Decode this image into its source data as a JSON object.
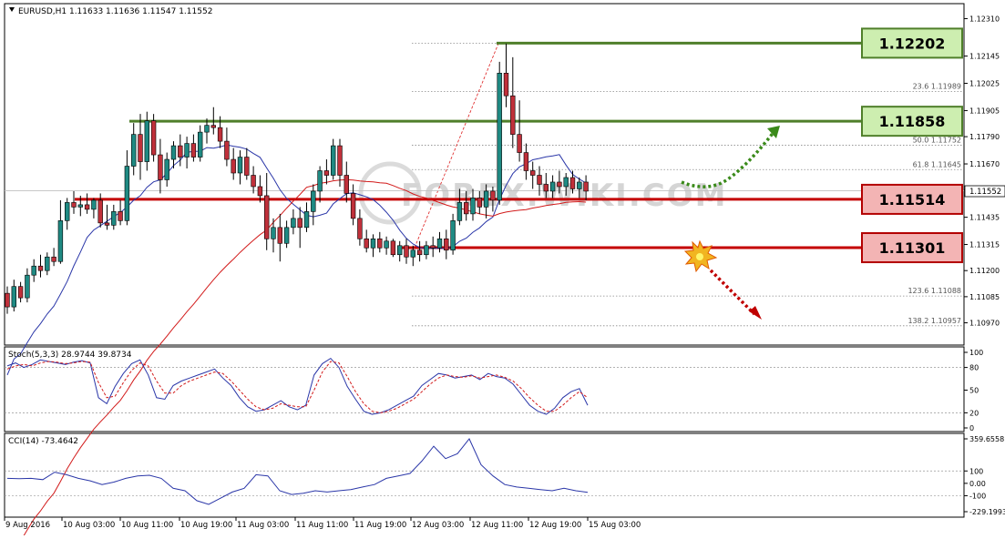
{
  "header": {
    "symbol_line": "EURUSD,H1  1.11633 1.11636 1.11547 1.11552"
  },
  "price_axis": {
    "ticks": [
      "1.12310",
      "1.12145",
      "1.12025",
      "1.11905",
      "1.11790",
      "1.11670",
      "1.11555",
      "1.11435",
      "1.11315",
      "1.11200",
      "1.11085",
      "1.10970"
    ],
    "current_price_label": "1.11552"
  },
  "levels": [
    {
      "label": "1.12202",
      "kind": "resistance"
    },
    {
      "label": "1.11858",
      "kind": "resistance"
    },
    {
      "label": "1.11514",
      "kind": "support"
    },
    {
      "label": "1.11301",
      "kind": "support"
    }
  ],
  "fibonacci": [
    {
      "label": "23.6  1.11989"
    },
    {
      "label": "50.0  1.11752"
    },
    {
      "label": "61.8  1.11645"
    },
    {
      "label": "123.6  1.11088"
    },
    {
      "label": "138.2  1.10957"
    }
  ],
  "stoch": {
    "title": "Stoch(5,3,3) 28.9744 39.8734",
    "ticks": [
      "100",
      "80",
      "50",
      "20",
      "0"
    ]
  },
  "cci": {
    "title": "CCI(14) -73.4642",
    "ticks": [
      "359.6558",
      "100",
      "0.00",
      "-100",
      "-229.1993"
    ]
  },
  "time_axis": {
    "labels": [
      "9 Aug 2016",
      "10 Aug 03:00",
      "10 Aug 11:00",
      "10 Aug 19:00",
      "11 Aug 03:00",
      "11 Aug 11:00",
      "11 Aug 19:00",
      "12 Aug 03:00",
      "12 Aug 11:00",
      "12 Aug 19:00",
      "15 Aug 03:00"
    ]
  },
  "watermark": "FOREX.WIKI.COM",
  "colors": {
    "bull": "#1f8a83",
    "bear": "#c0303a",
    "resistance_line": "#4f7f2a",
    "support_line": "#c40000",
    "resistance_box": "#cdeeb0",
    "support_box": "#f3b4b4",
    "ma_fast": "#2a36a8",
    "ma_slow": "#d21a1a",
    "bull_arrow": "#3a8a1a",
    "bear_arrow": "#c00000"
  },
  "chart_data": {
    "type": "candlestick",
    "symbol": "EURUSD",
    "timeframe": "H1",
    "ylim": [
      1.109,
      1.1236
    ],
    "candles": [
      [
        1.111,
        1.1113,
        1.1101,
        1.1104
      ],
      [
        1.1104,
        1.1116,
        1.1102,
        1.1113
      ],
      [
        1.1113,
        1.1115,
        1.1106,
        1.1108
      ],
      [
        1.1108,
        1.1121,
        1.1106,
        1.1118
      ],
      [
        1.1118,
        1.1125,
        1.1115,
        1.1122
      ],
      [
        1.1122,
        1.1127,
        1.1117,
        1.112
      ],
      [
        1.112,
        1.1128,
        1.1118,
        1.1126
      ],
      [
        1.1126,
        1.113,
        1.1122,
        1.1124
      ],
      [
        1.1124,
        1.1151,
        1.1123,
        1.1142
      ],
      [
        1.1142,
        1.1152,
        1.1138,
        1.115
      ],
      [
        1.115,
        1.1155,
        1.1145,
        1.1148
      ],
      [
        1.1148,
        1.1153,
        1.1144,
        1.1149
      ],
      [
        1.1149,
        1.1154,
        1.1145,
        1.1147
      ],
      [
        1.1147,
        1.1152,
        1.1143,
        1.1151
      ],
      [
        1.1151,
        1.1154,
        1.1139,
        1.1141
      ],
      [
        1.1141,
        1.1149,
        1.1138,
        1.114
      ],
      [
        1.114,
        1.1149,
        1.1138,
        1.1146
      ],
      [
        1.1146,
        1.1151,
        1.114,
        1.1142
      ],
      [
        1.1142,
        1.1173,
        1.114,
        1.1166
      ],
      [
        1.1166,
        1.1185,
        1.1162,
        1.118
      ],
      [
        1.118,
        1.1189,
        1.116,
        1.1168
      ],
      [
        1.1168,
        1.119,
        1.1164,
        1.1186
      ],
      [
        1.1186,
        1.1189,
        1.1168,
        1.1171
      ],
      [
        1.1171,
        1.1178,
        1.1154,
        1.116
      ],
      [
        1.116,
        1.1172,
        1.1157,
        1.1169
      ],
      [
        1.1169,
        1.1177,
        1.1165,
        1.1175
      ],
      [
        1.1175,
        1.118,
        1.1166,
        1.117
      ],
      [
        1.117,
        1.1179,
        1.1165,
        1.1176
      ],
      [
        1.1176,
        1.118,
        1.1168,
        1.117
      ],
      [
        1.117,
        1.1184,
        1.1168,
        1.1181
      ],
      [
        1.1181,
        1.1187,
        1.1176,
        1.1184
      ],
      [
        1.1184,
        1.1192,
        1.118,
        1.1183
      ],
      [
        1.1183,
        1.1188,
        1.1174,
        1.1177
      ],
      [
        1.1177,
        1.1183,
        1.1166,
        1.1169
      ],
      [
        1.1169,
        1.1174,
        1.116,
        1.1163
      ],
      [
        1.1163,
        1.1173,
        1.1158,
        1.117
      ],
      [
        1.117,
        1.1174,
        1.116,
        1.1162
      ],
      [
        1.1162,
        1.1166,
        1.1154,
        1.1157
      ],
      [
        1.1157,
        1.1162,
        1.115,
        1.1153
      ],
      [
        1.1153,
        1.1163,
        1.1129,
        1.1134
      ],
      [
        1.1134,
        1.1143,
        1.1128,
        1.1139
      ],
      [
        1.1139,
        1.1145,
        1.1124,
        1.1132
      ],
      [
        1.1132,
        1.1142,
        1.113,
        1.1139
      ],
      [
        1.1139,
        1.1147,
        1.1136,
        1.1143
      ],
      [
        1.1143,
        1.1148,
        1.113,
        1.1139
      ],
      [
        1.1139,
        1.115,
        1.1137,
        1.1146
      ],
      [
        1.1146,
        1.1158,
        1.114,
        1.1155
      ],
      [
        1.1155,
        1.1166,
        1.115,
        1.1164
      ],
      [
        1.1164,
        1.1169,
        1.1158,
        1.1162
      ],
      [
        1.1162,
        1.1178,
        1.116,
        1.1175
      ],
      [
        1.1175,
        1.1178,
        1.1157,
        1.1162
      ],
      [
        1.1162,
        1.1168,
        1.115,
        1.1154
      ],
      [
        1.1154,
        1.1158,
        1.114,
        1.1143
      ],
      [
        1.1143,
        1.1147,
        1.1131,
        1.1134
      ],
      [
        1.1134,
        1.1138,
        1.1128,
        1.113
      ],
      [
        1.113,
        1.1136,
        1.1126,
        1.1134
      ],
      [
        1.1134,
        1.1137,
        1.1128,
        1.113
      ],
      [
        1.113,
        1.1135,
        1.1127,
        1.1133
      ],
      [
        1.1133,
        1.1134,
        1.1126,
        1.1127
      ],
      [
        1.1127,
        1.1133,
        1.1124,
        1.1131
      ],
      [
        1.1131,
        1.1134,
        1.1123,
        1.1126
      ],
      [
        1.1126,
        1.1131,
        1.1122,
        1.1129
      ],
      [
        1.1129,
        1.1133,
        1.1124,
        1.1127
      ],
      [
        1.1127,
        1.1133,
        1.1125,
        1.1131
      ],
      [
        1.1131,
        1.1135,
        1.1126,
        1.113
      ],
      [
        1.113,
        1.1137,
        1.1128,
        1.1134
      ],
      [
        1.1134,
        1.1138,
        1.1125,
        1.1129
      ],
      [
        1.1129,
        1.1145,
        1.1127,
        1.1142
      ],
      [
        1.1142,
        1.1156,
        1.114,
        1.115
      ],
      [
        1.115,
        1.1155,
        1.1142,
        1.1145
      ],
      [
        1.1145,
        1.1156,
        1.1142,
        1.1152
      ],
      [
        1.1152,
        1.1155,
        1.1145,
        1.1148
      ],
      [
        1.1148,
        1.1158,
        1.1143,
        1.1155
      ],
      [
        1.1155,
        1.1157,
        1.1146,
        1.1151
      ],
      [
        1.1151,
        1.1212,
        1.1149,
        1.1207
      ],
      [
        1.1207,
        1.122,
        1.1192,
        1.1197
      ],
      [
        1.1197,
        1.1214,
        1.1174,
        1.118
      ],
      [
        1.118,
        1.1195,
        1.1168,
        1.1172
      ],
      [
        1.1172,
        1.1176,
        1.116,
        1.1164
      ],
      [
        1.1164,
        1.1168,
        1.1156,
        1.1162
      ],
      [
        1.1162,
        1.1166,
        1.1153,
        1.1158
      ],
      [
        1.1158,
        1.1163,
        1.1152,
        1.1155
      ],
      [
        1.1155,
        1.1162,
        1.1152,
        1.1159
      ],
      [
        1.1159,
        1.1164,
        1.1154,
        1.1157
      ],
      [
        1.1157,
        1.1163,
        1.1153,
        1.1161
      ],
      [
        1.1161,
        1.1164,
        1.1154,
        1.1156
      ],
      [
        1.1156,
        1.1161,
        1.1152,
        1.1159
      ],
      [
        1.1159,
        1.1162,
        1.1151,
        1.1155
      ]
    ],
    "ma_fast_color": "#2a36a8",
    "ma_slow_color": "#d21a1a",
    "horizontal_levels": [
      1.12202,
      1.11858,
      1.11514,
      1.11301
    ],
    "fib_levels": [
      1.11989,
      1.11752,
      1.11645,
      1.11088,
      1.10957
    ],
    "stoch_main": [
      82,
      86,
      80,
      84,
      90,
      88,
      86,
      84,
      87,
      89,
      86,
      40,
      32,
      55,
      72,
      85,
      90,
      70,
      40,
      38,
      56,
      62,
      66,
      70,
      74,
      78,
      66,
      56,
      40,
      28,
      22,
      24,
      30,
      36,
      28,
      24,
      30,
      70,
      85,
      92,
      80,
      55,
      38,
      22,
      18,
      20,
      24,
      30,
      36,
      42,
      56,
      64,
      72,
      70,
      66,
      68,
      70,
      64,
      72,
      68,
      66,
      58,
      44,
      30,
      22,
      18,
      26,
      40,
      48,
      52,
      30
    ],
    "stoch_signal": [
      78,
      82,
      84,
      82,
      86,
      88,
      87,
      85,
      86,
      88,
      87,
      60,
      40,
      42,
      60,
      76,
      86,
      82,
      62,
      46,
      46,
      56,
      62,
      66,
      70,
      74,
      72,
      62,
      50,
      38,
      28,
      24,
      26,
      32,
      30,
      28,
      28,
      50,
      74,
      88,
      86,
      68,
      48,
      32,
      22,
      20,
      22,
      26,
      32,
      38,
      48,
      58,
      66,
      70,
      68,
      67,
      69,
      66,
      68,
      70,
      67,
      62,
      52,
      40,
      30,
      22,
      22,
      30,
      40,
      48,
      40
    ],
    "cci": [
      40,
      38,
      40,
      30,
      90,
      70,
      40,
      20,
      -10,
      10,
      40,
      60,
      65,
      40,
      -40,
      -60,
      -140,
      -170,
      -120,
      -70,
      -40,
      70,
      60,
      -60,
      -90,
      -80,
      -60,
      -70,
      -60,
      -50,
      -30,
      -10,
      40,
      60,
      80,
      180,
      300,
      200,
      240,
      360,
      150,
      60,
      -10,
      -30,
      -40,
      -50,
      -60,
      -40,
      -60,
      -73
    ]
  }
}
